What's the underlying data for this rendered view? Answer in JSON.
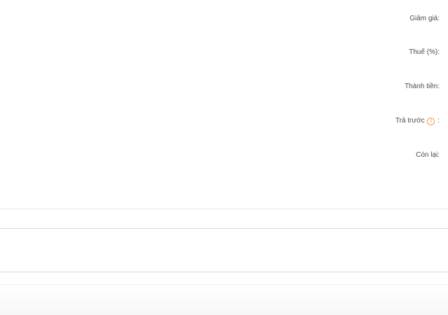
{
  "summary": {
    "discount_label": "Giảm giá:",
    "tax_label": "Thuế (%):",
    "total_label": "Thành tiền:",
    "prepaid_label": "Trả trước",
    "prepaid_suffix": ":",
    "prepaid_icon": "info-icon",
    "remaining_label": "Còn lại:"
  },
  "colors": {
    "label_text": "#4a4a4a",
    "info_icon": "#f0a040",
    "divider": "#e4e4e4"
  }
}
